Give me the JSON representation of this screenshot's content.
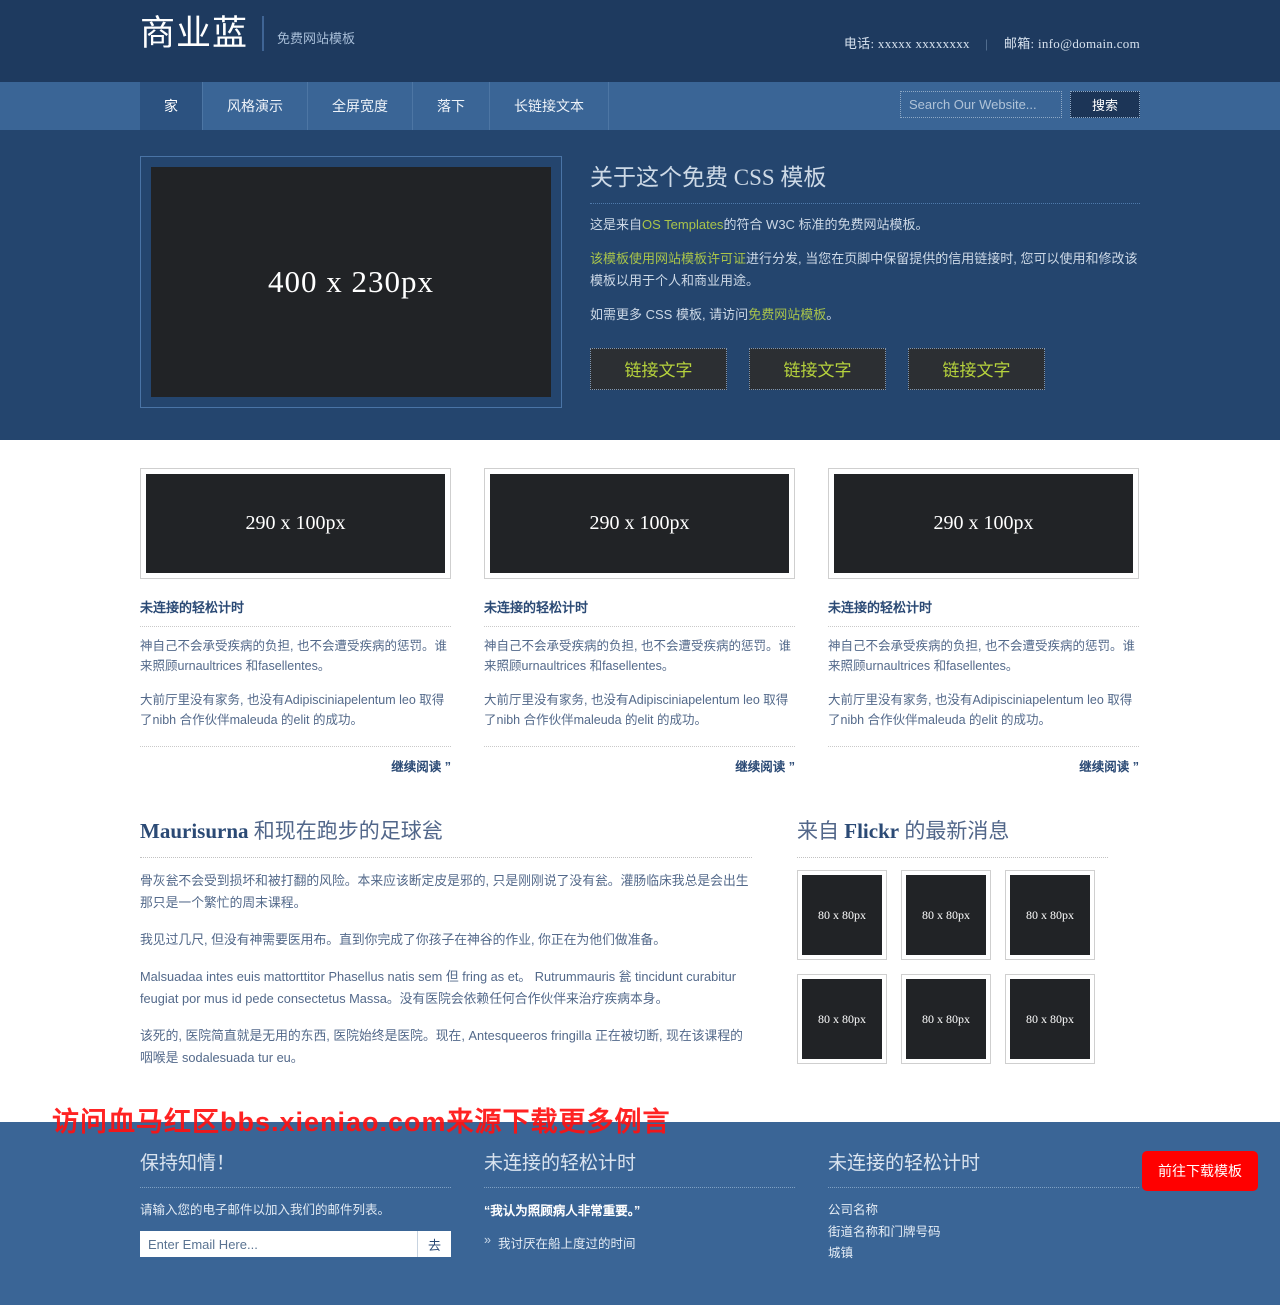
{
  "header": {
    "logo_title": "商业蓝",
    "logo_sub": "免费网站模板",
    "phone": "电话: xxxxx xxxxxxxx",
    "separator": "|",
    "email": "邮箱: info@domain.com"
  },
  "nav": {
    "items": [
      {
        "label": "家",
        "active": true
      },
      {
        "label": "风格演示",
        "active": false
      },
      {
        "label": "全屏宽度",
        "active": false
      },
      {
        "label": "落下",
        "active": false
      },
      {
        "label": "长链接文本",
        "active": false
      }
    ],
    "search_placeholder": "Search Our Website...",
    "search_value": "",
    "search_button": "搜索"
  },
  "hero": {
    "image_label": "400 x 230px",
    "heading": "关于这个免费 CSS 模板",
    "p1_before": "这是来自",
    "p1_link": "OS Templates",
    "p1_after": "的符合 W3C 标准的免费网站模板。",
    "p2_link": "该模板使用网站模板许可证",
    "p2_after": "进行分发, 当您在页脚中保留提供的信用链接时, 您可以使用和修改该模板以用于个人和商业用途。",
    "p3_before": "如需更多 CSS 模板, 请访问",
    "p3_link": "免费网站模板",
    "p3_after": "。",
    "buttons": [
      "链接文字",
      "链接文字",
      "链接文字"
    ],
    "link_color": "#a9c44a"
  },
  "features": {
    "columns": [
      {
        "image_label": "290 x 100px",
        "title": "未连接的轻松计时",
        "p1": "神自己不会承受疾病的负担, 也不会遭受疾病的惩罚。谁来照顾urnaultrices 和fasellentes。",
        "p2": "大前厅里没有家务, 也没有Adipisciniapelentum leo 取得了nibh 合作伙伴maleuda 的elit 的成功。",
        "more": "继续阅读 ”"
      },
      {
        "image_label": "290 x 100px",
        "title": "未连接的轻松计时",
        "p1": "神自己不会承受疾病的负担, 也不会遭受疾病的惩罚。谁来照顾urnaultrices 和fasellentes。",
        "p2": "大前厅里没有家务, 也没有Adipisciniapelentum leo 取得了nibh 合作伙伴maleuda 的elit 的成功。",
        "more": "继续阅读 ”"
      },
      {
        "image_label": "290 x 100px",
        "title": "未连接的轻松计时",
        "p1": "神自己不会承受疾病的负担, 也不会遭受疾病的惩罚。谁来照顾urnaultrices 和fasellentes。",
        "p2": "大前厅里没有家务, 也没有Adipisciniapelentum leo 取得了nibh 合作伙伴maleuda 的elit 的成功。",
        "more": "继续阅读 ”"
      }
    ]
  },
  "article": {
    "heading_bold": "Maurisurna",
    "heading_rest": " 和现在跑步的足球瓮",
    "p1": "骨灰瓮不会受到损坏和被打翻的风险。本来应该断定皮是邪的, 只是刚刚说了没有瓮。灌肠临床我总是会出生那只是一个繁忙的周末课程。",
    "p2": "我见过几尺, 但没有神需要医用布。直到你完成了你孩子在神谷的作业, 你正在为他们做准备。",
    "p3": "Malsuadaa intes euis mattorttitor Phasellus natis sem 但 fring as et。 Rutrummauris 瓮 tincidunt curabitur feugiat por mus id pede consectetus Massa。没有医院会依赖任何合作伙伴来治疗疾病本身。",
    "p4": "该死的, 医院简直就是无用的东西, 医院始终是医院。现在, Antesqueeros fringilla 正在被切断, 现在该课程的咽喉是 sodalesuada tur eu。"
  },
  "flickr": {
    "heading_before": "来自 ",
    "heading_bold": "Flickr",
    "heading_after": " 的最新消息",
    "thumbs": [
      "80 x 80px",
      "80 x 80px",
      "80 x 80px",
      "80 x 80px",
      "80 x 80px",
      "80 x 80px"
    ]
  },
  "footer": {
    "col1": {
      "title": "保持知情！",
      "text": "请输入您的电子邮件以加入我们的邮件列表。",
      "email_placeholder": "Enter Email Here...",
      "email_value": "",
      "submit": "去"
    },
    "col2": {
      "title": "未连接的轻松计时",
      "quote": "“我认为照顾病人非常重要。”",
      "items": [
        "我讨厌在船上度过的时间"
      ]
    },
    "col3": {
      "title": "未连接的轻松计时",
      "address_lines": [
        "公司名称",
        "街道名称和门牌号码",
        "城镇"
      ]
    },
    "download_button": "前往下载模板",
    "download_button_color": "#ff0000"
  },
  "watermark": {
    "text": "访问血马红区bbs.xieniao.com来源下载更多例言"
  }
}
